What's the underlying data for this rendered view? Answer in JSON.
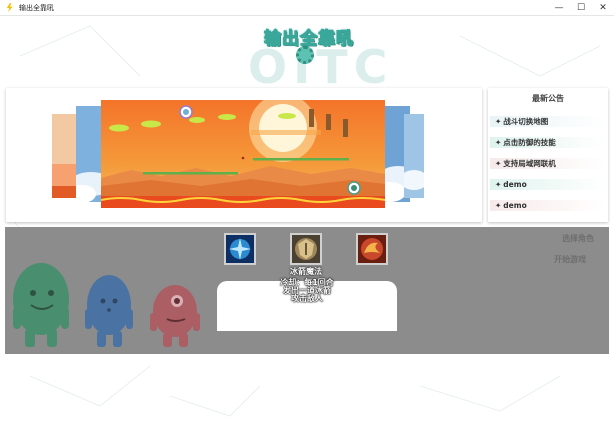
{
  "window": {
    "title": "输出全靠吼",
    "minimize_glyph": "—",
    "maximize_glyph": "☐",
    "close_glyph": "✕"
  },
  "logo": {
    "title": "输出全靠吼",
    "bg_text": "OITC"
  },
  "carousel": {
    "sky_color": "#6fa6d8",
    "sunset_color": "#f07a2a"
  },
  "notice": {
    "title": "最新公告",
    "items": [
      {
        "label": "战斗切换地图",
        "color": "#e8f4f6"
      },
      {
        "label": "点击防御的技能",
        "color": "#dff3ee"
      },
      {
        "label": "支持局域网联机",
        "color": "#f6eaea"
      },
      {
        "label": "demo",
        "color": "#dff3ee"
      },
      {
        "label": "demo",
        "color": "#f8eaea"
      }
    ]
  },
  "characters": {
    "mascots": [
      {
        "name": "green",
        "color": "#3e8f69"
      },
      {
        "name": "blue",
        "color": "#3f6fa8"
      },
      {
        "name": "red",
        "color": "#b2565f"
      }
    ]
  },
  "skills": {
    "icons": [
      {
        "name": "frost-skill-icon",
        "color": "#2a8bd0"
      },
      {
        "name": "shield-skill-icon",
        "color": "#a0875a"
      },
      {
        "name": "dragon-skill-icon",
        "color": "#c9472a"
      }
    ],
    "selected_name": "冰箭魔法",
    "description_lines": [
      "冷却：每1回合",
      "发出一道冰箭",
      "攻击敌人"
    ]
  },
  "right_actions": {
    "btn1": "选择角色",
    "btn2": "开始游戏"
  }
}
